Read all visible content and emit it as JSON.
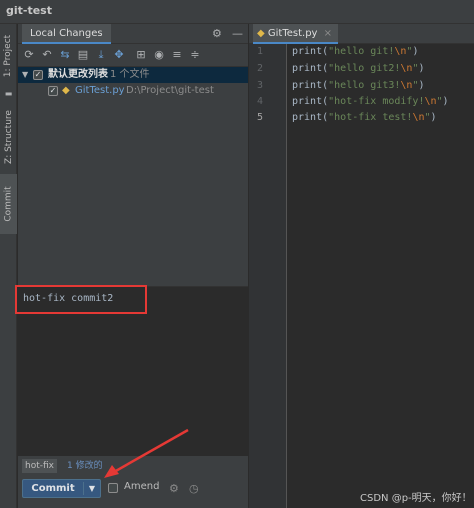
{
  "window": {
    "title": "git-test"
  },
  "side_tabs": {
    "project": "1: Project",
    "structure": "Z: Structure",
    "commit": "Commit"
  },
  "panel": {
    "tab": "Local Changes"
  },
  "tree": {
    "changelist": "默认更改列表",
    "changelist_count": "1 个文件",
    "file_name": "GitTest.py",
    "file_path": "D:\\Project\\git-test"
  },
  "commit_message": "hot-fix commit2",
  "status": {
    "branch": "hot-fix",
    "modified": "1 修改的"
  },
  "buttons": {
    "commit": "Commit",
    "amend": "Amend"
  },
  "editor": {
    "tab": "GitTest.py",
    "lines": [
      {
        "num": "1",
        "fn": "print(",
        "q1": "\"",
        "text": "hello git!",
        "esc": "\\n",
        "q2": "\"",
        "end": ")"
      },
      {
        "num": "2",
        "fn": "print(",
        "q1": "\"",
        "text": "hello git2!",
        "esc": "\\n",
        "q2": "\"",
        "end": ")"
      },
      {
        "num": "3",
        "fn": "print(",
        "q1": "\"",
        "text": "hello git3!",
        "esc": "\\n",
        "q2": "\"",
        "end": ")"
      },
      {
        "num": "4",
        "fn": "print(",
        "q1": "\"",
        "text": "hot-fix modify!",
        "esc": "\\n",
        "q2": "\"",
        "end": ")"
      },
      {
        "num": "5",
        "fn": "print(",
        "q1": "\"",
        "text": "hot-fix test!",
        "esc": "\\n",
        "q2": "\"",
        "end": ")"
      }
    ]
  },
  "watermark": "CSDN @p-明天，你好！",
  "colors": {
    "accent": "#4a88c7",
    "annotation": "#e53935",
    "string": "#6a8759",
    "escape": "#cc7832"
  }
}
